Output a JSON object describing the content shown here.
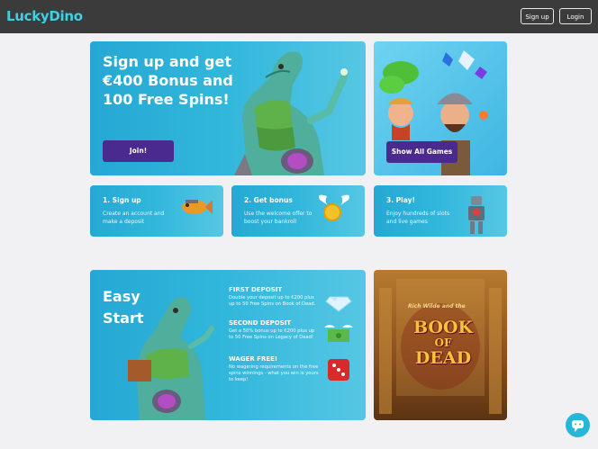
{
  "header": {
    "logo_text": "LuckyDino",
    "signup_label": "Sign up",
    "login_label": "Login"
  },
  "hero": {
    "title": "Sign up and get €400 Bonus and 100 Free Spins!",
    "join_label": "Join!"
  },
  "games_promo": {
    "button_label": "Show All Games"
  },
  "steps": [
    {
      "title": "1. Sign up",
      "desc": "Create an account and make a deposit"
    },
    {
      "title": "2. Get bonus",
      "desc": "Use the welcome offer to boost your bankroll"
    },
    {
      "title": "3. Play!",
      "desc": "Enjoy hundreds of slots and live games"
    }
  ],
  "easy_start": {
    "title": "Easy Start",
    "deposits": [
      {
        "title": "FIRST DEPOSIT",
        "desc": "Double your deposit up to €200 plus up to 50 Free Spins on Book of Dead."
      },
      {
        "title": "SECOND DEPOSIT",
        "desc": "Get a 50% bonus up to €200 plus up to 50 Free Spins on Legacy of Dead!"
      },
      {
        "title": "WAGER FREE!",
        "desc": "No wagering requirements on the free spins winnings - what you win is yours to keep!"
      }
    ]
  },
  "book_of_dead": {
    "subtitle": "Rich Wilde and the",
    "title_line1": "BOOK",
    "title_line2": "OF",
    "title_line3": "DEAD"
  },
  "colors": {
    "topbar": "#3b3b3b",
    "accent": "#3fd0e4",
    "button_purple": "#4a2a8e",
    "card_blue": "#32b7dc"
  }
}
